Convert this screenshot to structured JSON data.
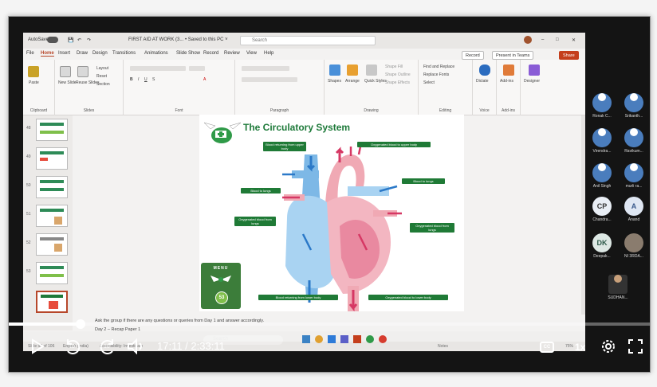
{
  "powerpoint": {
    "autosave": "AutoSave",
    "doc_title": "FIRST AID AT WORK (3... • Saved to this PC ˅",
    "search_placeholder": "Search",
    "menu": [
      "File",
      "Home",
      "Insert",
      "Draw",
      "Design",
      "Transitions",
      "Animations",
      "Slide Show",
      "Record",
      "Review",
      "View",
      "Help"
    ],
    "record_btn": "Record",
    "present_btn": "Present in Teams",
    "share_btn": "Share",
    "ribbon_groups": [
      "Clipboard",
      "Slides",
      "Font",
      "Paragraph",
      "Drawing",
      "Editing",
      "Voice",
      "Add-ins"
    ],
    "ribbon_labels": {
      "paste": "Paste",
      "new_slide": "New Slide",
      "reuse_slides": "Reuse Slides",
      "layout": "Layout",
      "reset": "Reset",
      "section": "Section",
      "shapes": "Shapes",
      "arrange": "Arrange",
      "quick_styles": "Quick Styles",
      "shape_fill": "Shape Fill",
      "shape_outline": "Shape Outline",
      "shape_effects": "Shape Effects",
      "find_replace": "Find and Replace",
      "replace_fonts": "Replace Fonts",
      "select": "Select",
      "dictate": "Dictate",
      "addins": "Add-ins",
      "designer": "Designer"
    },
    "thumbnail_numbers": [
      "48",
      "49",
      "50",
      "51",
      "52",
      "53"
    ],
    "slide": {
      "title": "The Circulatory System",
      "labels": {
        "blood_from_upper": "Blood returning from upper body",
        "oxy_to_upper": "Oxygenated blood to upper body",
        "blood_to_lungs_left": "Blood to lungs",
        "blood_to_lungs_right": "Blood to lungs",
        "oxy_from_lungs_left": "Oxygenated blood from lungs",
        "oxy_from_lungs_right": "Oxygenated blood from lungs",
        "blood_from_lower": "Blood returning from lower body",
        "oxy_to_lower": "Oxygenated blood to lower body"
      },
      "menu_text": "MENU",
      "slide_number": "53"
    },
    "notes": [
      "Ask the group if there are any questions or queries from Day 1 and answer accordingly.",
      "Day 2 – Recap Paper 1"
    ],
    "status": {
      "slide_info": "Slide 53 of 106",
      "language": "English (India)",
      "accessibility": "Accessibility: Investigate",
      "notes": "Notes",
      "zoom": "75%"
    }
  },
  "taskbar": {
    "search": "Search"
  },
  "participants": [
    {
      "name": "Ronak C...",
      "initials": "",
      "color": "#4a7dbd"
    },
    {
      "name": "Srikanth...",
      "initials": "",
      "color": "#4a7dbd"
    },
    {
      "name": "Virendra...",
      "initials": "",
      "color": "#4a7dbd"
    },
    {
      "name": "Ravikum...",
      "initials": "",
      "color": "#4a7dbd"
    },
    {
      "name": "Anil Singh",
      "initials": "",
      "color": "#4a7dbd"
    },
    {
      "name": "murli ra...",
      "initials": "",
      "color": "#4a7dbd"
    },
    {
      "name": "Chandra...",
      "initials": "CP",
      "color": "#e9eef5"
    },
    {
      "name": "Anand",
      "initials": "A",
      "color": "#dfe7f3"
    },
    {
      "name": "Deepak...",
      "initials": "DK",
      "color": "#dde8e4"
    },
    {
      "name": "NI 3RDA...",
      "initials": "",
      "color": "#8a7c6e"
    },
    {
      "name": "SUDHAN...",
      "initials": "",
      "color": "#333333"
    }
  ],
  "player": {
    "time": "17:11 / 2:33:11",
    "speed": "1x",
    "cc": "CC",
    "progress": 0.112,
    "rewind": "10",
    "forward": "10"
  }
}
